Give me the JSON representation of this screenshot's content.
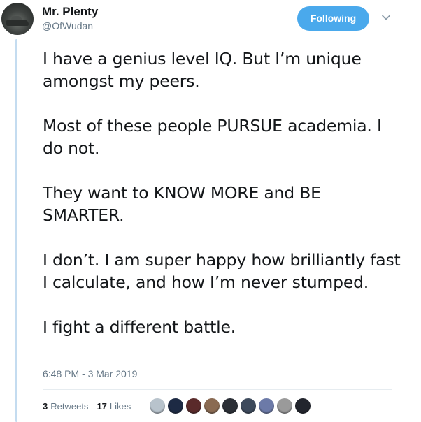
{
  "author": {
    "display_name": "Mr. Plenty",
    "handle": "@OfWudan"
  },
  "follow_button": {
    "label": "Following",
    "color": "#4aa9ec"
  },
  "more_icon": "chevron-down-icon",
  "tweet": {
    "paragraphs": [
      "I have a genius level IQ. But I’m unique amongst my peers.",
      "Most of these people PURSUE academia. I do not.",
      "They want to KNOW MORE and BE SMARTER.",
      "I don’t. I am super happy how brilliantly fast I calculate, and how I’m never stumped.",
      "I fight a different battle."
    ],
    "timestamp": "6:48 PM - 3 Mar 2019"
  },
  "stats": {
    "retweets": {
      "count": "3",
      "label": "Retweets"
    },
    "likes": {
      "count": "17",
      "label": "Likes"
    }
  },
  "likers": [
    {
      "name": "liker-avatar-1",
      "color": "#b8c3cc"
    },
    {
      "name": "liker-avatar-2",
      "color": "#1d2a44"
    },
    {
      "name": "liker-avatar-3",
      "color": "#5a2a2a"
    },
    {
      "name": "liker-avatar-4",
      "color": "#8a6a52"
    },
    {
      "name": "liker-avatar-5",
      "color": "#2b2f36"
    },
    {
      "name": "liker-avatar-6",
      "color": "#3d4a5c"
    },
    {
      "name": "liker-avatar-7",
      "color": "#6c7aa8"
    },
    {
      "name": "liker-avatar-8",
      "color": "#9a9a9a"
    },
    {
      "name": "liker-avatar-9",
      "color": "#22252d"
    }
  ],
  "colors": {
    "thread_line": "#c4dcf0",
    "secondary_text": "#657786",
    "primary_text": "#14171a"
  }
}
